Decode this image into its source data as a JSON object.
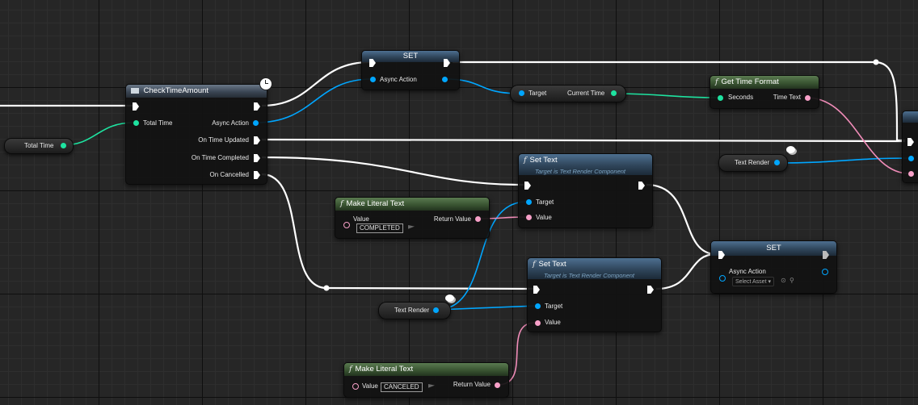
{
  "nodes": {
    "check_time": {
      "title": "CheckTimeAmount",
      "pins": {
        "total_time": "Total Time",
        "async_action": "Async Action",
        "on_time_updated": "On Time Updated",
        "on_time_completed": "On Time Completed",
        "on_cancelled": "On Cancelled"
      }
    },
    "total_time_var": {
      "label": "Total Time"
    },
    "set_top": {
      "title": "SET",
      "pins": {
        "async_action": "Async Action"
      }
    },
    "current_time": {
      "pins": {
        "target": "Target",
        "current_time": "Current Time"
      }
    },
    "get_time_format": {
      "title": "Get Time Format",
      "pins": {
        "seconds": "Seconds",
        "time_text": "Time Text"
      }
    },
    "text_render_top": {
      "label": "Text Render"
    },
    "set_text_1": {
      "title": "Set Text",
      "subtitle": "Target is Text Render Component",
      "pins": {
        "target": "Target",
        "value": "Value"
      }
    },
    "make_literal_1": {
      "title": "Make Literal Text",
      "pins": {
        "value": "Value",
        "return_value": "Return Value"
      },
      "value_text": "COMPLETED"
    },
    "set_bottom": {
      "title": "SET",
      "pins": {
        "async_action": "Async Action"
      },
      "select_asset": "Select Asset"
    },
    "set_text_2": {
      "title": "Set Text",
      "subtitle": "Target is Text Render Component",
      "pins": {
        "target": "Target",
        "value": "Value"
      }
    },
    "text_render_bottom": {
      "label": "Text Render"
    },
    "make_literal_2": {
      "title": "Make Literal Text",
      "pins": {
        "value": "Value",
        "return_value": "Return Value"
      },
      "value_text": "CANCELED"
    }
  },
  "colors": {
    "exec": "#ffffff",
    "object": "#00a6ff",
    "float": "#1ee3a0",
    "text": "#f7a0c8"
  }
}
